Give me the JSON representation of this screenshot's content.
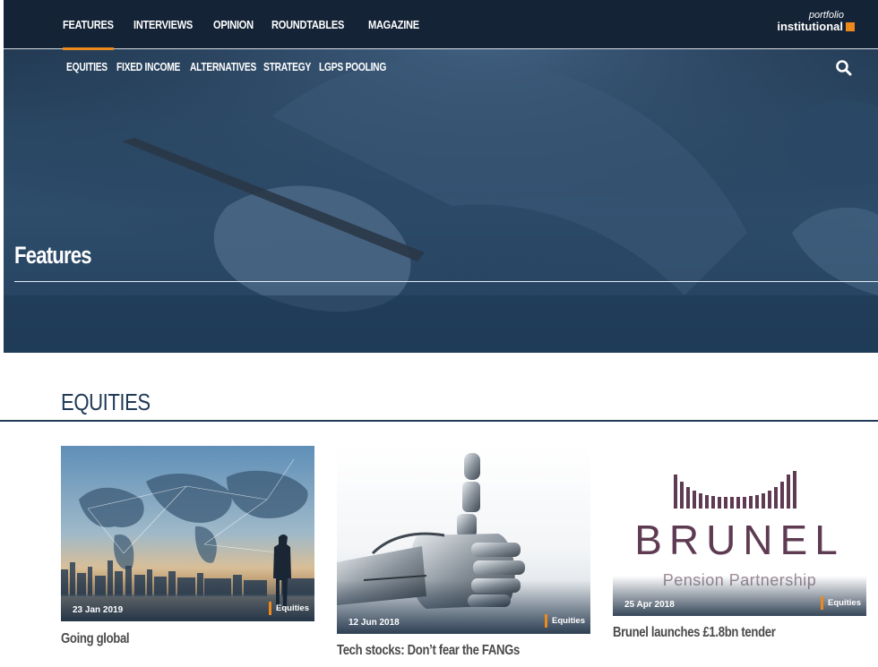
{
  "nav": {
    "primary": [
      "FEATURES",
      "INTERVIEWS",
      "OPINION",
      "ROUNDTABLES",
      "MAGAZINE"
    ],
    "active_index": 0,
    "secondary": [
      "EQUITIES",
      "FIXED INCOME",
      "ALTERNATIVES",
      "STRATEGY",
      "LGPS POOLING"
    ]
  },
  "logo": {
    "line1": "portfolio",
    "line2": "institutional"
  },
  "hero": {
    "title": "Features"
  },
  "section": {
    "title": "EQUITIES"
  },
  "cards": [
    {
      "date": "23 Jan 2019",
      "tag": "Equities",
      "headline": "Going global"
    },
    {
      "date": "12 Jun 2018",
      "tag": "Equities",
      "headline": "Tech stocks: Don’t fear the FANGs"
    },
    {
      "date": "25 Apr 2018",
      "tag": "Equities",
      "headline": "Brunel launches £1.8bn tender",
      "logo_word": "BRUNEL",
      "logo_sub": "Pension Partnership"
    }
  ],
  "colors": {
    "navy": "#142336",
    "accent": "#ee8a1c",
    "section": "#1f3a57",
    "brunel": "#5e3b52"
  },
  "icons": [
    "search-icon"
  ]
}
